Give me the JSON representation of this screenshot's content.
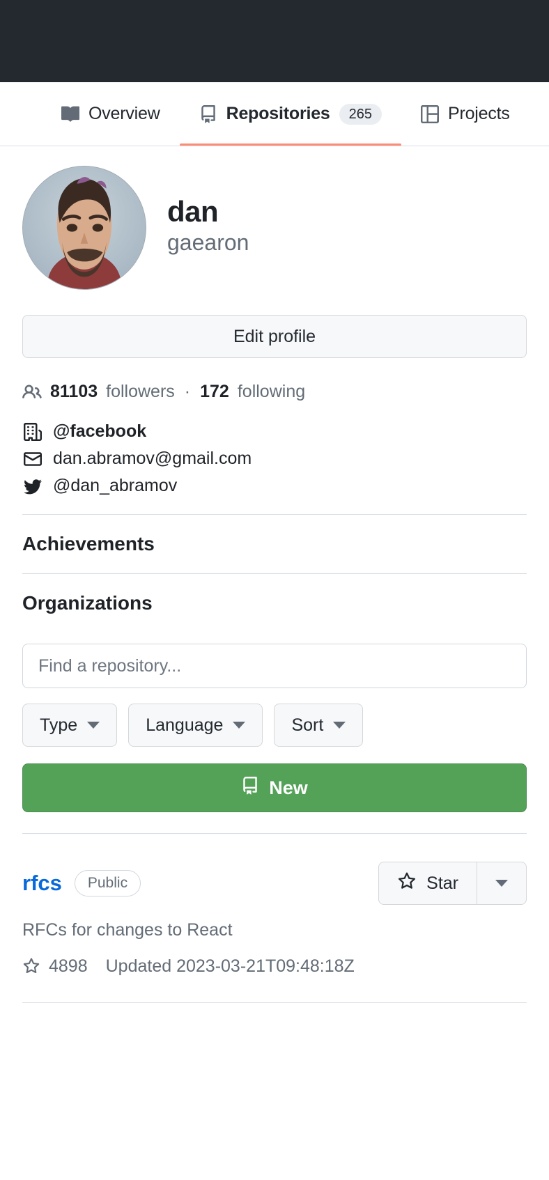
{
  "nav": {
    "tabs": [
      {
        "label": "Overview",
        "icon": "book-icon",
        "count": null,
        "active": false
      },
      {
        "label": "Repositories",
        "icon": "repo-icon",
        "count": "265",
        "active": true
      },
      {
        "label": "Projects",
        "icon": "table-icon",
        "count": null,
        "active": false
      }
    ]
  },
  "profile": {
    "avatar_alt": "avatar",
    "full_name": "dan",
    "login": "gaearon",
    "edit_profile_label": "Edit profile",
    "followers_count": "81103",
    "followers_label": "followers",
    "separator": "·",
    "following_count": "172",
    "following_label": "following",
    "contacts": [
      {
        "icon": "organization-icon",
        "text": "@facebook",
        "type": "org"
      },
      {
        "icon": "mail-icon",
        "text": "dan.abramov@gmail.com",
        "type": "email"
      },
      {
        "icon": "twitter-icon",
        "text": "@dan_abramov",
        "type": "twitter"
      }
    ]
  },
  "sections": {
    "achievements_title": "Achievements",
    "organizations_title": "Organizations"
  },
  "repo_toolbar": {
    "search_placeholder": "Find a repository...",
    "search_value": "",
    "filters": [
      {
        "label": "Type"
      },
      {
        "label": "Language"
      },
      {
        "label": "Sort"
      }
    ],
    "new_button_label": "New",
    "new_button_color": "#54a158"
  },
  "repositories": [
    {
      "name": "rfcs",
      "visibility": "Public",
      "description": "RFCs for changes to React",
      "stars": "4898",
      "updated": "Updated 2023-03-21T09:48:18Z",
      "star_button_label": "Star"
    }
  ],
  "colors": {
    "link": "#0969da",
    "accent_underline": "#fd8c73",
    "muted": "#636c76",
    "chrome": "#24292f"
  }
}
